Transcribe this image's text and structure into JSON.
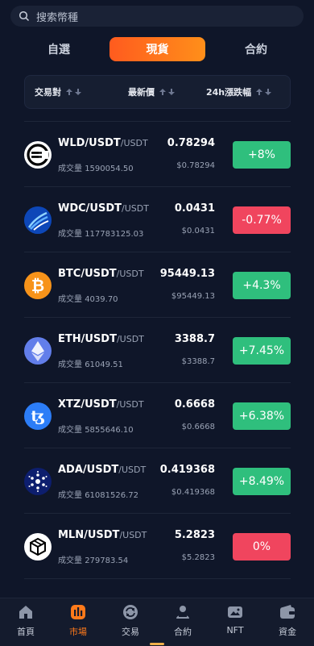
{
  "search": {
    "placeholder": "搜索幣種"
  },
  "tabs": [
    "自選",
    "現貨",
    "合約"
  ],
  "header": {
    "pair": "交易對",
    "price": "最新價",
    "change": "24h漲跌幅"
  },
  "volume_label": "成交量",
  "rows": [
    {
      "base": "WLD/USDT",
      "quote": "/USDT",
      "volume": "1590054.50",
      "price": "0.78294",
      "sub_price": "$0.78294",
      "change": "+8%",
      "dir": "up",
      "icon": "worldcoin-icon"
    },
    {
      "base": "WDC/USDT",
      "quote": "/USDT",
      "volume": "117783125.03",
      "price": "0.0431",
      "sub_price": "$0.0431",
      "change": "-0.77%",
      "dir": "down",
      "icon": "wdc-icon"
    },
    {
      "base": "BTC/USDT",
      "quote": "/USDT",
      "volume": "4039.70",
      "price": "95449.13",
      "sub_price": "$95449.13",
      "change": "+4.3%",
      "dir": "up",
      "icon": "bitcoin-icon"
    },
    {
      "base": "ETH/USDT",
      "quote": "/USDT",
      "volume": "61049.51",
      "price": "3388.7",
      "sub_price": "$3388.7",
      "change": "+7.45%",
      "dir": "up",
      "icon": "ethereum-icon"
    },
    {
      "base": "XTZ/USDT",
      "quote": "/USDT",
      "volume": "5855646.10",
      "price": "0.6668",
      "sub_price": "$0.6668",
      "change": "+6.38%",
      "dir": "up",
      "icon": "tezos-icon"
    },
    {
      "base": "ADA/USDT",
      "quote": "/USDT",
      "volume": "61081526.72",
      "price": "0.419368",
      "sub_price": "$0.419368",
      "change": "+8.49%",
      "dir": "up",
      "icon": "cardano-icon"
    },
    {
      "base": "MLN/USDT",
      "quote": "/USDT",
      "volume": "279783.54",
      "price": "5.2823",
      "sub_price": "$5.2823",
      "change": "0%",
      "dir": "down",
      "icon": "melon-icon"
    }
  ],
  "nav": [
    {
      "label": "首頁",
      "icon": "home-icon"
    },
    {
      "label": "市場",
      "icon": "market-icon",
      "active": true
    },
    {
      "label": "交易",
      "icon": "trade-icon"
    },
    {
      "label": "合約",
      "icon": "contract-icon"
    },
    {
      "label": "NFT",
      "icon": "nft-icon"
    },
    {
      "label": "資金",
      "icon": "wallet-icon"
    }
  ],
  "colors": {
    "up": "#2fbf7d",
    "down": "#f0455e",
    "accent": "#ff7a1a"
  }
}
